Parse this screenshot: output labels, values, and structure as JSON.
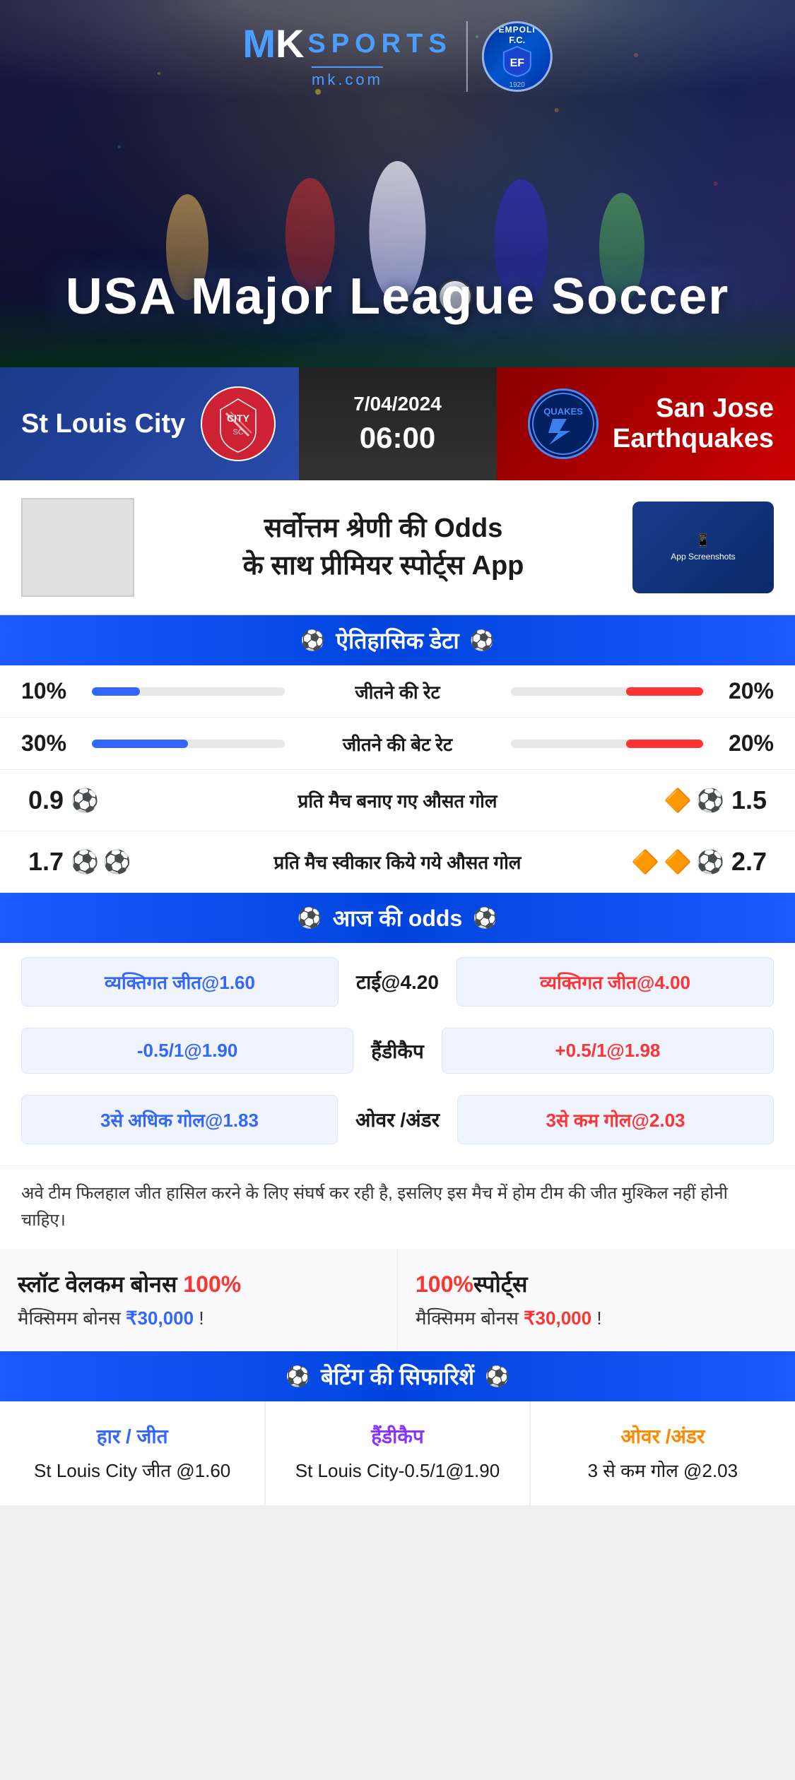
{
  "brand": {
    "mk": "MK",
    "sports": "SPORTS",
    "domain": "mk.com",
    "empoli_name": "EMPOLI F.C.",
    "empoli_fc": "EF",
    "empoli_year": "1920"
  },
  "hero": {
    "title": "USA Major League Soccer",
    "bg_gradient": "#1a1a2e"
  },
  "match": {
    "date": "7/04/2024",
    "time": "06:00",
    "home_team": "St Louis City",
    "away_team": "San Jose Earthquakes",
    "away_team_line1": "San Jose",
    "away_team_line2": "Earthquakes",
    "away_team_abbr": "QUAKES"
  },
  "promo": {
    "text_line1": "सर्वोत्तम श्रेणी की",
    "text_highlight": "Odds",
    "text_line2": "के साथ प्रीमियर स्पोर्ट्स",
    "text_app": "App"
  },
  "historical": {
    "section_title": "ऐतिहासिक डेटा",
    "stats": [
      {
        "label": "जीतने की रेट",
        "left_value": "10%",
        "right_value": "20%",
        "left_bar_pct": 25,
        "right_bar_pct": 40
      },
      {
        "label": "जीतने की बेट रेट",
        "left_value": "30%",
        "right_value": "20%",
        "left_bar_pct": 50,
        "right_bar_pct": 40
      },
      {
        "label": "प्रति मैच बनाए गए औसत गोल",
        "left_value": "0.9",
        "right_value": "1.5",
        "left_balls": 1,
        "right_balls": 2
      },
      {
        "label": "प्रति मैच स्वीकार किये गये औसत गोल",
        "left_value": "1.7",
        "right_value": "2.7",
        "left_balls": 2,
        "right_balls": 3
      }
    ]
  },
  "odds": {
    "section_title": "आज की odds",
    "rows": [
      {
        "left_label": "व्यक्तिगत जीत@1.60",
        "center_label": "टाई@4.20",
        "right_label": "व्यक्तिगत जीत@4.00"
      },
      {
        "left_label": "-0.5/1@1.90",
        "center_label": "हैंडीकैप",
        "right_label": "+0.5/1@1.98"
      },
      {
        "left_label": "3से अधिक गोल@1.83",
        "center_label": "ओवर /अंडर",
        "right_label": "3से कम गोल@2.03"
      }
    ]
  },
  "analysis": {
    "text": "अवे टीम फिलहाल जीत हासिल करने के लिए संघर्ष कर रही है, इसलिए इस मैच में होम टीम की जीत मुश्किल नहीं होनी चाहिए।"
  },
  "bonus": {
    "card1_title": "स्लॉट वेलकम बोनस 100%",
    "card1_subtitle": "मैक्सिमम बोनस ₹30,000  !",
    "card2_title": "100%स्पोर्ट्स",
    "card2_subtitle": "मैक्सिमम बोनस  ₹30,000 !"
  },
  "recommendations": {
    "section_title": "बेटिंग की सिफारिशें",
    "cards": [
      {
        "type": "हार / जीत",
        "value": "St Louis City जीत @1.60",
        "color": "blue"
      },
      {
        "type": "हैंडीकैप",
        "value": "St Louis City-0.5/1@1.90",
        "color": "purple"
      },
      {
        "type": "ओवर /अंडर",
        "value": "3 से कम गोल @2.03",
        "color": "orange"
      }
    ]
  }
}
